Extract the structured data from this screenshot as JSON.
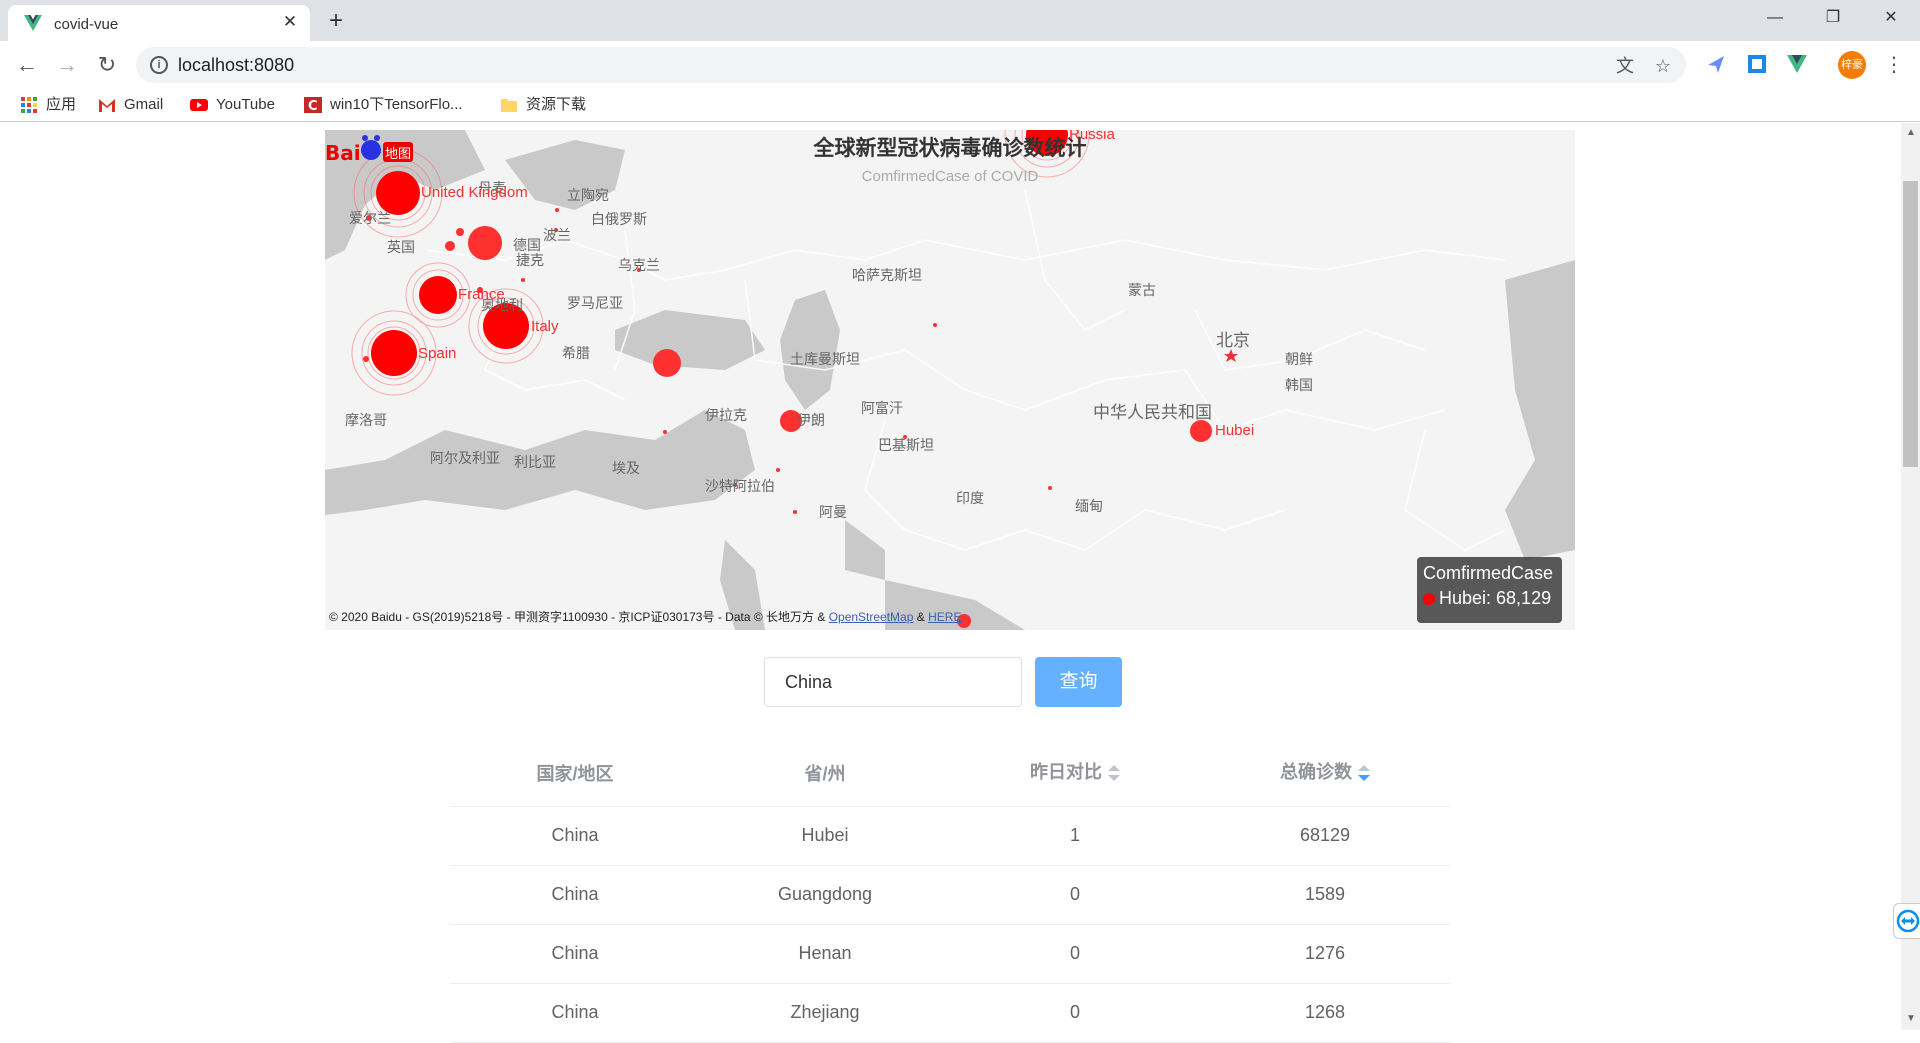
{
  "browser": {
    "tab_title": "covid-vue",
    "url": "localhost:8080",
    "profile_name": "梓豪",
    "bookmarks": [
      "应用",
      "Gmail",
      "YouTube",
      "win10下TensorFlo...",
      "资源下载"
    ]
  },
  "map": {
    "title": "全球新型冠状病毒确诊数统计",
    "subtitle": "ComfirmedCase of COVID",
    "places": [
      "爱尔兰",
      "英国",
      "丹麦",
      "立陶宛",
      "白俄罗斯",
      "波兰",
      "德国",
      "捷克",
      "乌克兰",
      "罗马尼亚",
      "奥地利",
      "希腊",
      "摩洛哥",
      "阿尔及利亚",
      "利比亚",
      "埃及",
      "伊拉克",
      "沙特阿拉伯",
      "伊朗",
      "土库曼斯坦",
      "阿富汗",
      "巴基斯坦",
      "哈萨克斯坦",
      "蒙古",
      "北京",
      "朝鲜",
      "韩国",
      "中华人民共和国",
      "印度",
      "缅甸",
      "阿曼"
    ],
    "markers": [
      {
        "name": "United Kingdom"
      },
      {
        "name": "France"
      },
      {
        "name": "Italy"
      },
      {
        "name": "Spain"
      },
      {
        "name": "Russia"
      },
      {
        "name": "Hubei"
      }
    ],
    "copyright": "© 2020 Baidu - GS(2019)5218号 - 甲测资字1100930 - 京ICP证030173号 - Data © 长地万方 &",
    "link_osm": "OpenStreetMap",
    "amp": "&",
    "link_here": "HERE",
    "tooltip": {
      "title": "ComfirmedCase",
      "row": "Hubei: 68,129"
    }
  },
  "search": {
    "value": "China",
    "button_label": "查询"
  },
  "table": {
    "headers": [
      "国家/地区",
      "省/州",
      "昨日对比",
      "总确诊数"
    ],
    "rows": [
      [
        "China",
        "Hubei",
        "1",
        "68129"
      ],
      [
        "China",
        "Guangdong",
        "0",
        "1589"
      ],
      [
        "China",
        "Henan",
        "0",
        "1276"
      ],
      [
        "China",
        "Zhejiang",
        "0",
        "1268"
      ]
    ]
  }
}
